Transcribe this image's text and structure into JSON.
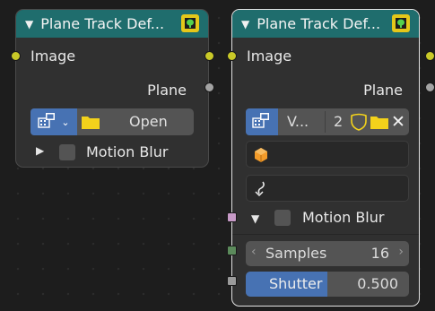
{
  "nodes": [
    {
      "title": "Plane Track Def...",
      "collapse_glyph": "▼",
      "image_label": "Image",
      "plane_label": "Plane",
      "clip_button_label": "Open",
      "motion_blur_label": "Motion Blur",
      "motion_blur_expanded": false,
      "motion_blur_checked": false
    },
    {
      "title": "Plane Track Def...",
      "collapse_glyph": "▼",
      "image_label": "Image",
      "plane_label": "Plane",
      "clip_name": "V...",
      "clip_users": "2",
      "motion_blur_label": "Motion Blur",
      "motion_blur_expanded": true,
      "motion_blur_checked": false,
      "samples_label": "Samples",
      "samples_value": "16",
      "shutter_label": "Shutter",
      "shutter_value": "0.500"
    }
  ],
  "icons": {
    "node_header": "plane-track-icon",
    "clip_browse": "movie-clip-browse-icon",
    "folder": "folder-icon",
    "fake_user": "shield-icon",
    "unlink": "close-icon",
    "tracking_object": "cube-icon",
    "plane_track": "curve-track-icon"
  },
  "colors": {
    "header": "#1f6d6d",
    "node_body": "#303030",
    "canvas": "#1d1d1d",
    "socket_image": "#c9c928",
    "socket_plane": "#a3a3a3",
    "socket_samples": "#5b8a5b",
    "socket_shutter": "#9a9a9a",
    "socket_blur": "#c79ac7",
    "slider_fill": "#4772b3",
    "selection_outline": "#e2e2e2"
  }
}
